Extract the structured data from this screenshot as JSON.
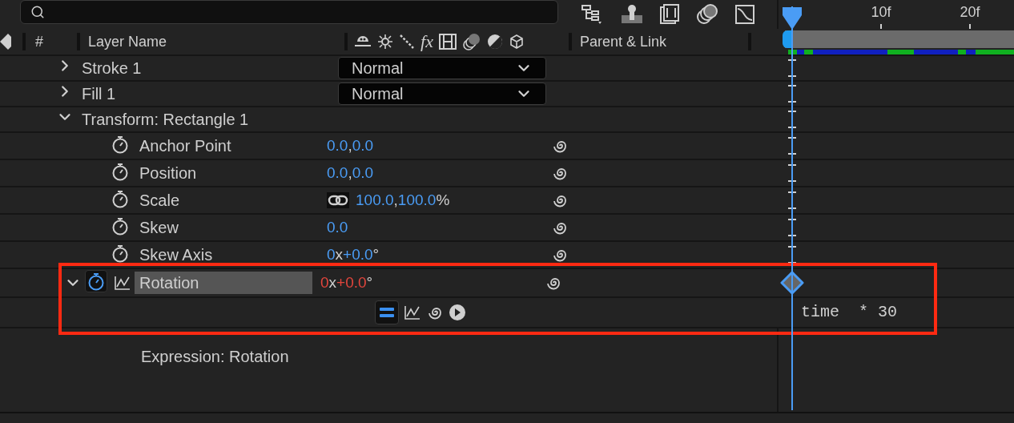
{
  "columns": {
    "number": "#",
    "layer_name": "Layer Name",
    "fx": "fx",
    "parent": "Parent & Link"
  },
  "ruler": [
    {
      "label": "10f"
    },
    {
      "label": "20f"
    }
  ],
  "groups": [
    {
      "name": "Stroke 1",
      "expanded": false,
      "blend_mode": "Normal"
    },
    {
      "name": "Fill 1",
      "expanded": false,
      "blend_mode": "Normal"
    },
    {
      "name": "Transform: Rectangle 1",
      "expanded": true,
      "children": [
        {
          "name": "Anchor Point",
          "stopwatch_on": false,
          "selected": false,
          "keyframed": false,
          "value": [
            {
              "text": "0.0",
              "kind": "number"
            },
            {
              "text": ",",
              "kind": "unit"
            },
            {
              "text": "0.0",
              "kind": "number"
            }
          ]
        },
        {
          "name": "Position",
          "stopwatch_on": false,
          "selected": false,
          "keyframed": false,
          "value": [
            {
              "text": "0.0",
              "kind": "number"
            },
            {
              "text": ",",
              "kind": "unit"
            },
            {
              "text": "0.0",
              "kind": "number"
            }
          ]
        },
        {
          "name": "Scale",
          "stopwatch_on": false,
          "selected": false,
          "keyframed": false,
          "constrain": true,
          "value": [
            {
              "text": "100.0",
              "kind": "number"
            },
            {
              "text": ",",
              "kind": "unit"
            },
            {
              "text": "100.0",
              "kind": "number"
            },
            {
              "text": "%",
              "kind": "unit"
            }
          ]
        },
        {
          "name": "Skew",
          "stopwatch_on": false,
          "selected": false,
          "keyframed": false,
          "value": [
            {
              "text": "0.0",
              "kind": "number"
            }
          ]
        },
        {
          "name": "Skew Axis",
          "stopwatch_on": false,
          "selected": false,
          "keyframed": false,
          "value": [
            {
              "text": "0",
              "kind": "number"
            },
            {
              "text": "x",
              "kind": "unit"
            },
            {
              "text": "+0.0",
              "kind": "number"
            },
            {
              "text": "°",
              "kind": "unit"
            }
          ]
        },
        {
          "name": "Rotation",
          "stopwatch_on": true,
          "selected": true,
          "keyframed": true,
          "expanded": true,
          "value": [
            {
              "text": "0",
              "kind": "number"
            },
            {
              "text": "x",
              "kind": "unit"
            },
            {
              "text": "+0.0",
              "kind": "number"
            },
            {
              "text": "°",
              "kind": "unit"
            }
          ],
          "expression": {
            "enabled": true,
            "text": "time  * 30"
          }
        }
      ]
    }
  ],
  "expression_label": "Expression: Rotation"
}
